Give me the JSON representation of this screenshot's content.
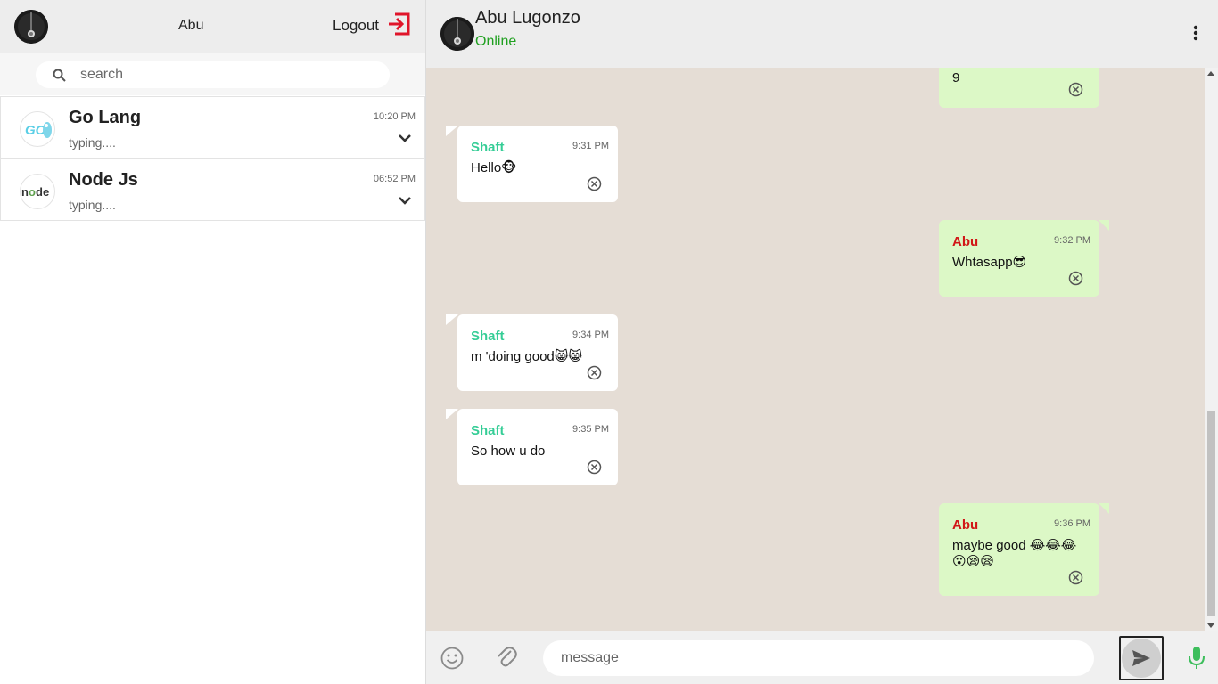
{
  "sidebar": {
    "user_name": "Abu",
    "logout_label": "Logout",
    "search_placeholder": "search",
    "chats": [
      {
        "title": "Go Lang",
        "time": "10:20 PM",
        "subtitle": "typing....",
        "icon": "golang-logo"
      },
      {
        "title": "Node Js",
        "time": "06:52 PM",
        "subtitle": "typing....",
        "icon": "nodejs-logo"
      }
    ]
  },
  "conversation": {
    "contact_name": "Abu Lugonzo",
    "status": "Online",
    "messages": [
      {
        "direction": "out",
        "sender": "",
        "time": "",
        "text": "9"
      },
      {
        "direction": "in",
        "sender": "Shaft",
        "time": "9:31 PM",
        "text": "Hello🐵"
      },
      {
        "direction": "out",
        "sender": "Abu",
        "time": "9:32 PM",
        "text": "Whtasapp😎"
      },
      {
        "direction": "in",
        "sender": "Shaft",
        "time": "9:34 PM",
        "text": "m 'doing good😸😸"
      },
      {
        "direction": "in",
        "sender": "Shaft",
        "time": "9:35 PM",
        "text": "So how u do"
      },
      {
        "direction": "out",
        "sender": "Abu",
        "time": "9:36 PM",
        "text": "maybe good 😂😂😂😮😪😪"
      }
    ],
    "input_placeholder": "message"
  },
  "colors": {
    "accent_green": "#35cd96",
    "outgoing_bubble": "#dcf8c6",
    "incoming_bubble": "#ffffff",
    "chat_background": "#e5ddd5",
    "logout_red": "#e0152a",
    "own_sender_red": "#d11717",
    "online_green": "#20a020",
    "mic_green": "#3dbe5c"
  },
  "icons": {
    "logout": "logout-icon",
    "search": "search-icon",
    "chevron": "chevron-down-icon",
    "menu": "vertical-dots-icon",
    "delete": "circle-x-icon",
    "emoji": "smiley-icon",
    "attach": "paperclip-icon",
    "send": "send-icon",
    "mic": "microphone-icon"
  }
}
